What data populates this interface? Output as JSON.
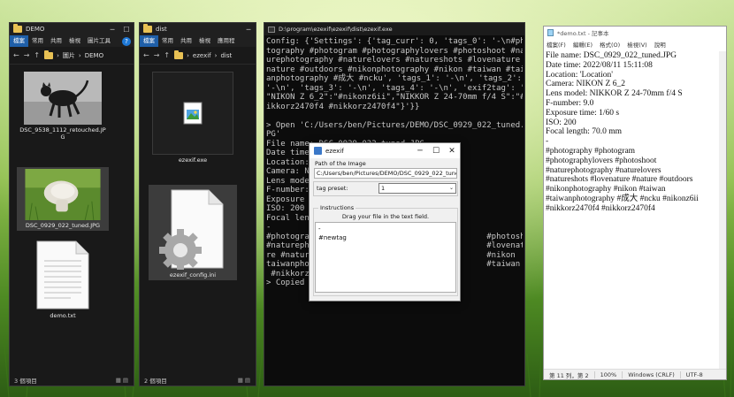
{
  "explorer_demo": {
    "title": "DEMO",
    "menu": [
      "檔案",
      "常用",
      "共用",
      "檢視",
      "圖片工具"
    ],
    "active_menu_index": 0,
    "breadcrumb": [
      "圖片",
      "DEMO"
    ],
    "files": [
      {
        "name": "DSC_9538_1112_retouched.JPG",
        "type": "photo-cat"
      },
      {
        "name": "DSC_0929_022_tuned.JPG",
        "type": "photo-mushroom"
      },
      {
        "name": "demo.txt",
        "type": "text"
      }
    ],
    "status": "3 個項目"
  },
  "explorer_dist": {
    "title": "dist",
    "menu": [
      "檔案",
      "常用",
      "共用",
      "檢視",
      "應用程"
    ],
    "active_menu_index": 0,
    "breadcrumb": [
      "ezexif",
      "dist"
    ],
    "files": [
      {
        "name": "ezexif.exe",
        "type": "exe"
      },
      {
        "name": "ezexif_config.ini",
        "type": "config"
      }
    ],
    "status": "2 個項目"
  },
  "console": {
    "title": "D:\\program\\ezexif\\ezexif\\dist\\ezexif.exe",
    "lines": [
      "Config: {'Settings': {'tag_curr': 0, 'tags_0': '-\\n#pho",
      "tography #photogram #photographylovers #photoshoot #nat",
      "urephotography #naturelovers #natureshots #lovenature #",
      "nature #outdoors #nikonphotography #nikon #taiwan #taiw",
      "anphotography #成大 #ncku', 'tags_1': '-\\n', 'tags_2':",
      "'-\\n', 'tags_3': '-\\n', 'tags_4': '-\\n', 'exif2tag': '(",
      "\"NIKON Z 6_2\":\"#nikonz6ii\",\"NIKKOR Z 24-70mm f/4 S\":\"#n",
      "ikkorz2470f4 #nikkorz2470f4\"}'}}",
      "",
      "> Open 'C:/Users/ben/Pictures/DEMO/DSC_0929_022_tuned.J",
      "PG'",
      "File name: DSC_0929_022_tuned.JPG",
      "Date time",
      "Location:",
      "Camera: NI",
      "Lens model",
      "F-number:",
      "Exposure t",
      "ISO: 200",
      "Focal leng",
      "-",
      "#photograp                                    #photoshoot",
      "#naturephc                                    #lovenatu",
      "re #natur                                     #nikon",
      "taiwanphot                                    #taiwan #",
      " #nikkorz2",
      "> Copied t"
    ]
  },
  "notepad": {
    "title": "*demo.txt - 記事本",
    "menu": [
      "檔案(F)",
      "編輯(E)",
      "格式(O)",
      "檢視(V)",
      "說明"
    ],
    "lines": [
      "File name: DSC_0929_022_tuned.JPG",
      "Date time: 2022/08/11 15:11:08",
      "Location: 'Location'",
      "Camera: NIKON Z 6_2",
      "Lens model: NIKKOR Z 24-70mm f/4 S",
      "F-number: 9.0",
      "Exposure time: 1/60 s",
      "ISO: 200",
      "Focal length: 70.0 mm",
      "-",
      "#photography #photogram",
      "#photographylovers #photoshoot",
      "#naturephotography #naturelovers",
      "#natureshots #lovenature #nature #outdoors",
      "#nikonphotography #nikon #taiwan",
      "#taiwanphotography #成大 #ncku #nikonz6ii",
      "#nikkorz2470f4 #nikkorz2470f4"
    ],
    "status": {
      "position": "第 11 列，第 2",
      "zoom": "100%",
      "line_ending": "Windows (CRLF)",
      "encoding": "UTF-8"
    }
  },
  "ezexif": {
    "title": "ezexif",
    "path_label": "Path of the Image",
    "path_value": "C:/Users/ben/Pictures/DEMO/DSC_0929_022_tuned.J",
    "tag_preset_label": "tag preset:",
    "tag_preset_value": "1",
    "instructions_label": "Instructions",
    "instructions_text": "Drag your file in the text field.",
    "text_content": "-\n#newtag"
  },
  "colors": {
    "explorer_bg": "#191919",
    "console_bg": "#0c0c0c",
    "accent": "#1f5fa8"
  }
}
